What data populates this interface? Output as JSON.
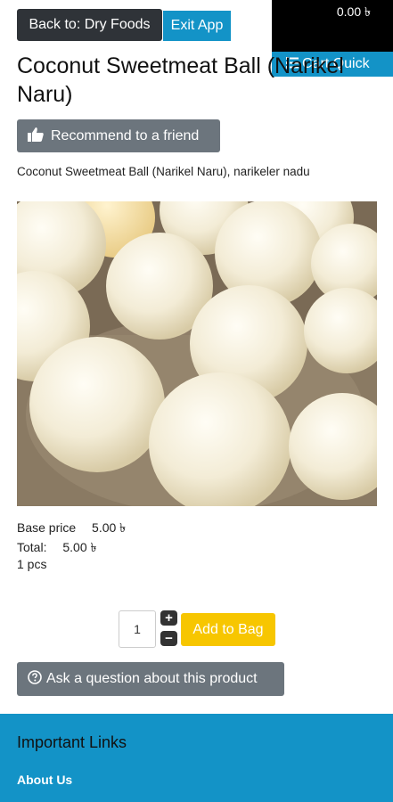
{
  "nav": {
    "back_label": "Back to: Dry Foods",
    "exit_label": "Exit App"
  },
  "cart": {
    "total": "0.00 ৳",
    "quick_label": "Cart Quick"
  },
  "product": {
    "title": "Coconut Sweetmeat Ball (Narikel Naru)",
    "recommend_label": "Recommend to a friend",
    "description": "Coconut Sweetmeat Ball (Narikel Naru), narikeler nadu",
    "base_price_label": "Base price",
    "base_price": "5.00 ৳",
    "total_label": "Total:",
    "total": "5.00 ৳",
    "unit": "1 pcs",
    "quantity": "1",
    "add_label": "Add to Bag",
    "ask_label": "Ask a question about this product"
  },
  "footer": {
    "heading": "Important Links",
    "link_about": "About Us"
  },
  "colors": {
    "accent": "#1393c7",
    "add_button": "#f7c600",
    "secondary_button": "#6c757d"
  }
}
